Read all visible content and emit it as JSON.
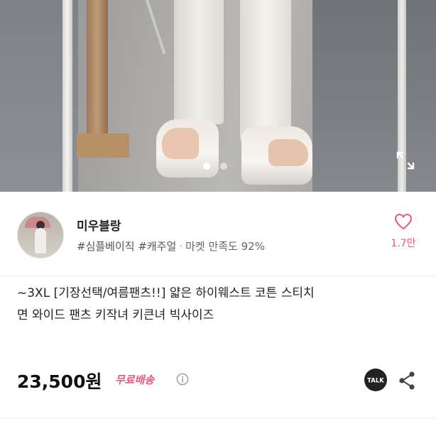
{
  "gallery": {
    "slide_count": 2,
    "active_index": 0,
    "expand_icon": "expand-icon"
  },
  "seller": {
    "name": "미우블랑",
    "tags": "#심플베이직 #캐주얼",
    "separator": "·",
    "satisfaction": "마켓 만족도 92%",
    "like_count": "1.7만",
    "like_icon": "heart-outline-icon",
    "accent_color": "#e8587a"
  },
  "product": {
    "title_line1": "~3XL [기장선택/여름팬츠!!] 얇은 하이웨스트 코튼 스티치",
    "title_line2": "면 와이드 팬츠 키작녀 키큰녀 빅사이즈",
    "price": "23,500원",
    "shipping": "무료배송",
    "info_icon": "info-icon",
    "talk_label": "TALK",
    "share_icon": "share-icon"
  }
}
